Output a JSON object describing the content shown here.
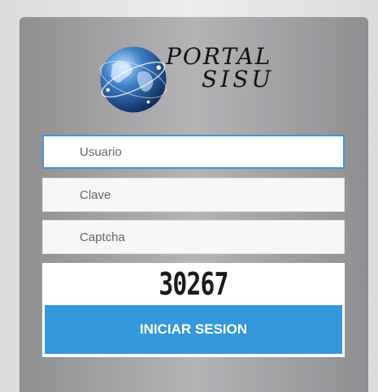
{
  "logo": {
    "line1": "PORTAL",
    "line2": "SISU"
  },
  "form": {
    "user_placeholder": "Usuario",
    "password_placeholder": "Clave",
    "captcha_placeholder": "Captcha",
    "captcha_code": "30267",
    "submit_label": "INICIAR SESION"
  },
  "colors": {
    "accent": "#3498db",
    "focus_border": "#4a90d9",
    "panel": "#a3a3a6"
  },
  "icons": {
    "logo": "globe-icon"
  }
}
